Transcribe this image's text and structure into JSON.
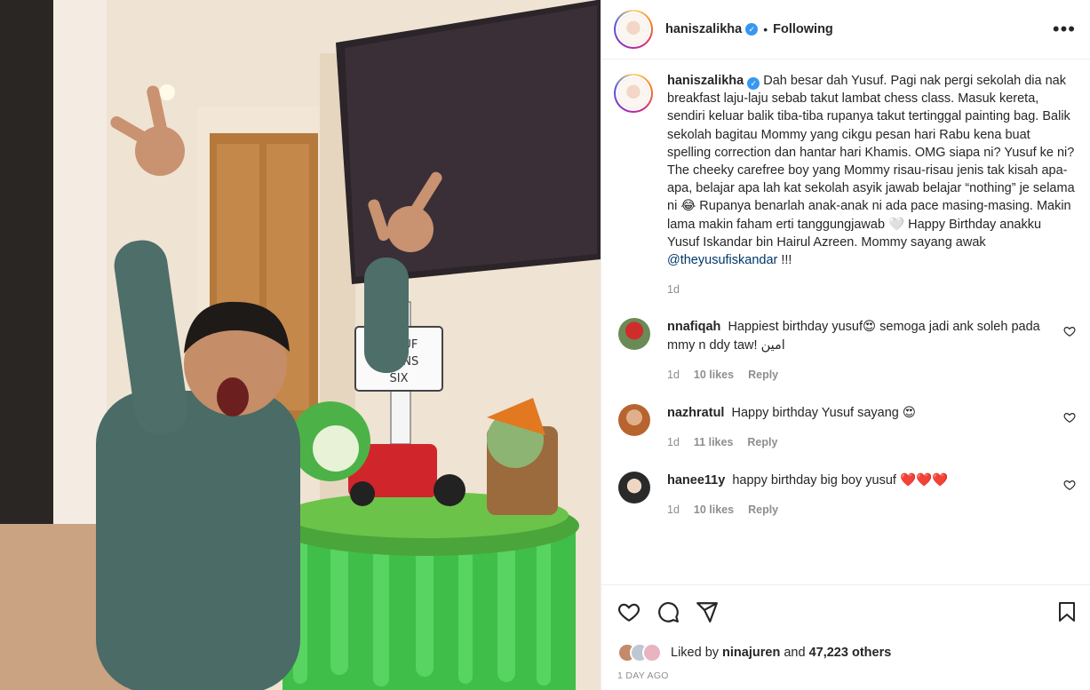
{
  "post": {
    "author": "haniszalikha",
    "follow_state": "Following",
    "separator": "•",
    "more_label": "•••",
    "verified_mark": "✓",
    "photo_sign_text": "YUSUF TURNS SIX",
    "caption_text": "Dah besar dah Yusuf. Pagi nak pergi sekolah dia nak breakfast laju-laju sebab takut lambat chess class. Masuk kereta, sendiri keluar balik tiba-tiba rupanya takut tertinggal painting bag. Balik sekolah bagitau Mommy yang cikgu pesan hari Rabu kena buat spelling correction dan hantar hari Khamis. OMG siapa ni? Yusuf ke ni? The cheeky carefree boy yang Mommy risau-risau jenis tak kisah apa-apa, belajar apa lah kat sekolah asyik jawab belajar “nothing” je selama ni 😂 Rupanya benarlah anak-anak ni ada pace masing-masing. Makin lama makin faham erti tanggungjawab 🤍 Happy Birthday anakku Yusuf Iskandar bin Hairul Azreen. Mommy sayang awak",
    "caption_mention": "@theyusufiskandar",
    "caption_suffix": " !!!",
    "caption_age": "1d"
  },
  "comments": [
    {
      "user": "nnafiqah",
      "text": "Happiest birthday yusuf😍 semoga jadi ank soleh pada mmy n ddy taw! امين",
      "age": "1d",
      "likes": "10 likes",
      "reply": "Reply"
    },
    {
      "user": "nazhratul",
      "text": "Happy birthday Yusuf sayang 😍",
      "age": "1d",
      "likes": "11 likes",
      "reply": "Reply"
    },
    {
      "user": "hanee11y",
      "text": "happy birthday big boy yusuf ❤️❤️❤️",
      "age": "1d",
      "likes": "10 likes",
      "reply": "Reply"
    }
  ],
  "likes": {
    "prefix": "Liked by ",
    "user": "ninajuren",
    "middle": " and ",
    "count": "47,223 others"
  },
  "timestamp": "1 DAY AGO",
  "colors": {
    "accent_link": "#00376b",
    "verified": "#3897f0",
    "muted": "#8e8e8e",
    "cake_green": "#3fbf4a"
  },
  "icons": [
    "heart-icon",
    "comment-icon",
    "share-icon",
    "bookmark-icon",
    "more-icon",
    "verified-badge-icon"
  ]
}
